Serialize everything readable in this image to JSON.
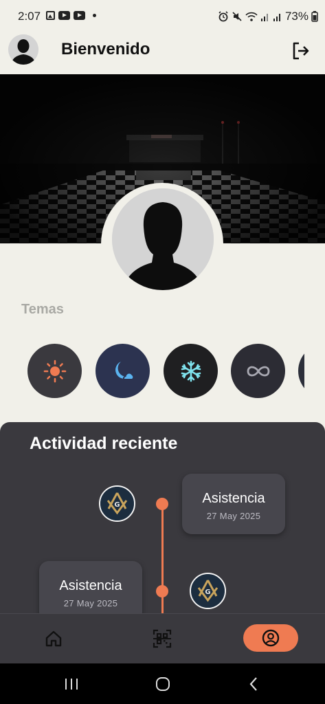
{
  "status_bar": {
    "time": "2:07",
    "battery": "73%",
    "left_icons": [
      "image-icon",
      "youtube-icon",
      "youtube-icon",
      "dot-icon"
    ],
    "right_icons": [
      "alarm-icon",
      "mute-icon",
      "wifi-icon",
      "signal-icon",
      "signal-icon",
      "battery-icon"
    ]
  },
  "header": {
    "title": "Bienvenido",
    "avatar_icon": "user-avatar-icon",
    "logout_icon": "logout-icon"
  },
  "themes": {
    "title": "Temas",
    "items": [
      {
        "name": "light",
        "icon": "sun-icon",
        "bg": "#3a393e",
        "fg": "#ef7b52"
      },
      {
        "name": "night",
        "icon": "moon-cloud-icon",
        "bg": "#2c3350",
        "fg": "#5bb4f0"
      },
      {
        "name": "frost",
        "icon": "snowflake-icon",
        "bg": "#1f1f21",
        "fg": "#7fe3ee"
      },
      {
        "name": "infinite",
        "icon": "infinity-icon",
        "bg": "#2c2c34",
        "fg": "#a9a9b2"
      },
      {
        "name": "more",
        "icon": "theme-partial-icon",
        "bg": "#2c2f3a",
        "fg": "#ffffff"
      }
    ]
  },
  "activity": {
    "title": "Actividad reciente",
    "items": [
      {
        "title": "Asistencia",
        "date": "27 May 2025",
        "logo": "masonic-logo-icon"
      },
      {
        "title": "Asistencia",
        "date": "27 May 2025",
        "logo": "masonic-logo-icon"
      }
    ]
  },
  "bottom_nav": {
    "items": [
      {
        "icon": "home-icon",
        "active": false
      },
      {
        "icon": "qr-scan-icon",
        "active": false
      },
      {
        "icon": "profile-icon",
        "active": true
      }
    ]
  },
  "system_nav": {
    "items": [
      "recents-icon",
      "home-circle-icon",
      "back-icon"
    ]
  },
  "colors": {
    "accent": "#ef7b52",
    "background": "#f1f0e9",
    "panel": "#3a393e",
    "card": "#47464d"
  }
}
